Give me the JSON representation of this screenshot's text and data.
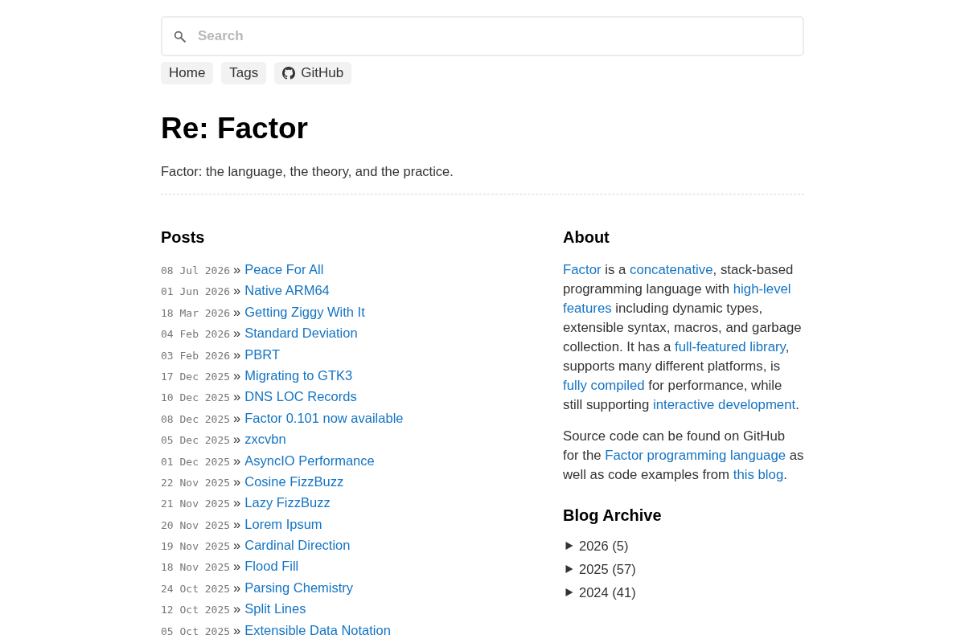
{
  "search": {
    "placeholder": "Search"
  },
  "nav": [
    {
      "label": "Home",
      "kind": "plain"
    },
    {
      "label": "Tags",
      "kind": "plain"
    },
    {
      "label": "GitHub",
      "kind": "with-icon"
    }
  ],
  "header": {
    "title": "Re: Factor",
    "tagline": "Factor: the language, the theory, and the practice."
  },
  "posts": {
    "heading": "Posts",
    "items": [
      {
        "date": "08 Jul 2026",
        "separator": "»",
        "title": "Peace For All"
      },
      {
        "date": "01 Jun 2026",
        "separator": "»",
        "title": "Native ARM64"
      },
      {
        "date": "18 Mar 2026",
        "separator": "»",
        "title": "Getting Ziggy With It"
      },
      {
        "date": "04 Feb 2026",
        "separator": "»",
        "title": "Standard Deviation"
      },
      {
        "date": "03 Feb 2026",
        "separator": "»",
        "title": "PBRT"
      },
      {
        "date": "17 Dec 2025",
        "separator": "»",
        "title": "Migrating to GTK3"
      },
      {
        "date": "10 Dec 2025",
        "separator": "»",
        "title": "DNS LOC Records"
      },
      {
        "date": "08 Dec 2025",
        "separator": "»",
        "title": "Factor 0.101 now available"
      },
      {
        "date": "05 Dec 2025",
        "separator": "»",
        "title": "zxcvbn"
      },
      {
        "date": "01 Dec 2025",
        "separator": "»",
        "title": "AsyncIO Performance"
      },
      {
        "date": "22 Nov 2025",
        "separator": "»",
        "title": "Cosine FizzBuzz"
      },
      {
        "date": "21 Nov 2025",
        "separator": "»",
        "title": "Lazy FizzBuzz"
      },
      {
        "date": "20 Nov 2025",
        "separator": "»",
        "title": "Lorem Ipsum"
      },
      {
        "date": "19 Nov 2025",
        "separator": "»",
        "title": "Cardinal Direction"
      },
      {
        "date": "18 Nov 2025",
        "separator": "»",
        "title": "Flood Fill"
      },
      {
        "date": "24 Oct 2025",
        "separator": "»",
        "title": "Parsing Chemistry"
      },
      {
        "date": "12 Oct 2025",
        "separator": "»",
        "title": "Split Lines"
      },
      {
        "date": "05 Oct 2025",
        "separator": "»",
        "title": "Extensible Data Notation"
      }
    ]
  },
  "about": {
    "heading": "About",
    "paragraphs": [
      [
        {
          "kind": "link",
          "text": "Factor"
        },
        {
          "kind": "text",
          "text": " is a "
        },
        {
          "kind": "link",
          "text": "concatenative"
        },
        {
          "kind": "text",
          "text": ", stack-based programming language with "
        },
        {
          "kind": "link",
          "text": "high-level"
        },
        {
          "kind": "link",
          "text": "features"
        },
        {
          "kind": "text",
          "text": " including dynamic types, extensible syntax, macros, and garbage collection. It has a "
        },
        {
          "kind": "link",
          "text": "full-featured library"
        },
        {
          "kind": "text",
          "text": ", supports many different platforms, is "
        },
        {
          "kind": "link",
          "text": "fully compiled"
        },
        {
          "kind": "text",
          "text": " for performance, while still supporting "
        },
        {
          "kind": "link",
          "text": "interactive"
        },
        {
          "kind": "link",
          "text": "development"
        },
        {
          "kind": "text",
          "text": "."
        }
      ],
      [
        {
          "kind": "text",
          "text": "Source code can be found on GitHub for the "
        },
        {
          "kind": "link",
          "text": "Factor programming language"
        },
        {
          "kind": "text",
          "text": " as well as code examples from "
        },
        {
          "kind": "link",
          "text": "this"
        },
        {
          "kind": "link",
          "text": "blog"
        },
        {
          "kind": "text",
          "text": "."
        }
      ]
    ]
  },
  "archive": {
    "heading": "Blog Archive",
    "items": [
      {
        "label": "2026 (5)",
        "expanded": false
      },
      {
        "label": "2025 (57)",
        "expanded": false
      },
      {
        "label": "2024 (41)",
        "expanded": false
      }
    ]
  }
}
